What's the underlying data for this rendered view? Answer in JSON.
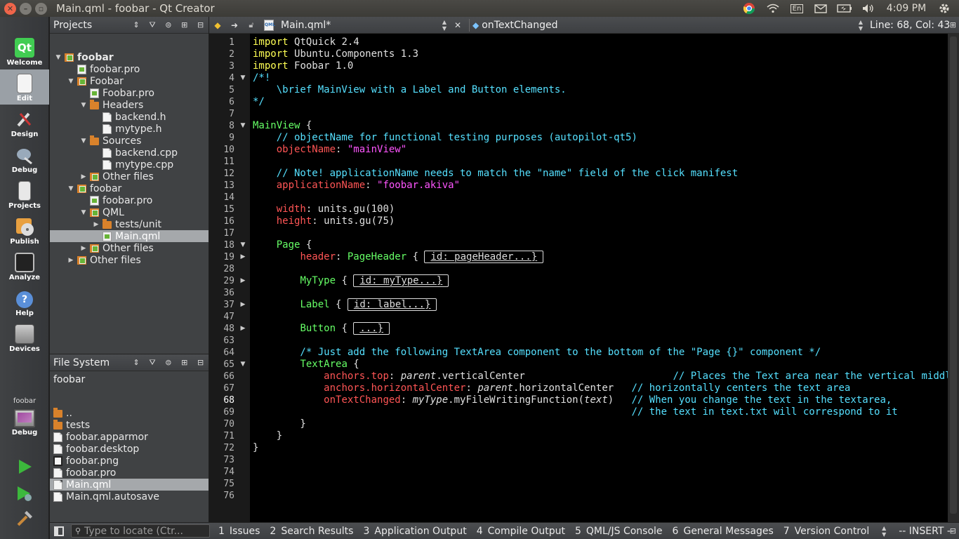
{
  "window": {
    "title": "Main.qml - foobar - Qt Creator",
    "clock": "4:09 PM",
    "keyboard_indicator": "En"
  },
  "modes": [
    {
      "label": "Welcome",
      "icon": "qt-logo-icon"
    },
    {
      "label": "Edit",
      "icon": "edit-document-icon",
      "active": true
    },
    {
      "label": "Design",
      "icon": "design-tools-icon"
    },
    {
      "label": "Debug",
      "icon": "debug-bug-icon"
    },
    {
      "label": "Projects",
      "icon": "projects-icon"
    },
    {
      "label": "Publish",
      "icon": "publish-disc-icon"
    },
    {
      "label": "Analyze",
      "icon": "analyze-monitor-icon"
    },
    {
      "label": "Help",
      "icon": "help-icon"
    },
    {
      "label": "Devices",
      "icon": "devices-icon"
    }
  ],
  "kit": {
    "name": "foobar",
    "label": "Debug"
  },
  "projects": {
    "title": "Projects",
    "items": [
      {
        "label": "foobar",
        "depth": 0,
        "arrow": "down",
        "icon": "proj",
        "bold": true
      },
      {
        "label": "foobar.pro",
        "depth": 1,
        "arrow": "",
        "icon": "qtproj"
      },
      {
        "label": "Foobar",
        "depth": 1,
        "arrow": "down",
        "icon": "proj"
      },
      {
        "label": "Foobar.pro",
        "depth": 2,
        "arrow": "",
        "icon": "qtproj"
      },
      {
        "label": "Headers",
        "depth": 2,
        "arrow": "down",
        "icon": "folder"
      },
      {
        "label": "backend.h",
        "depth": 3,
        "arrow": "",
        "icon": "file"
      },
      {
        "label": "mytype.h",
        "depth": 3,
        "arrow": "",
        "icon": "file"
      },
      {
        "label": "Sources",
        "depth": 2,
        "arrow": "down",
        "icon": "folder"
      },
      {
        "label": "backend.cpp",
        "depth": 3,
        "arrow": "",
        "icon": "file"
      },
      {
        "label": "mytype.cpp",
        "depth": 3,
        "arrow": "",
        "icon": "file"
      },
      {
        "label": "Other files",
        "depth": 2,
        "arrow": "right",
        "icon": "proj"
      },
      {
        "label": "foobar",
        "depth": 1,
        "arrow": "down",
        "icon": "proj"
      },
      {
        "label": "foobar.pro",
        "depth": 2,
        "arrow": "",
        "icon": "qtproj"
      },
      {
        "label": "QML",
        "depth": 2,
        "arrow": "down",
        "icon": "proj"
      },
      {
        "label": "tests/unit",
        "depth": 3,
        "arrow": "right",
        "icon": "folder"
      },
      {
        "label": "Main.qml",
        "depth": 3,
        "arrow": "",
        "icon": "qtproj",
        "selected": true
      },
      {
        "label": "Other files",
        "depth": 2,
        "arrow": "right",
        "icon": "proj"
      },
      {
        "label": "Other files",
        "depth": 1,
        "arrow": "right",
        "icon": "proj"
      }
    ]
  },
  "filesystem": {
    "title": "File System",
    "path": "foobar",
    "items": [
      {
        "label": "..",
        "icon": "folder"
      },
      {
        "label": "tests",
        "icon": "folder"
      },
      {
        "label": "foobar.apparmor",
        "icon": "file"
      },
      {
        "label": "foobar.desktop",
        "icon": "file"
      },
      {
        "label": "foobar.png",
        "icon": "img"
      },
      {
        "label": "foobar.pro",
        "icon": "file"
      },
      {
        "label": "Main.qml",
        "icon": "file",
        "selected": true
      },
      {
        "label": "Main.qml.autosave",
        "icon": "file"
      }
    ]
  },
  "editor": {
    "file": "Main.qml*",
    "symbol": "onTextChanged",
    "position": "Line: 68, Col: 43",
    "current_line": "68",
    "lines": [
      {
        "n": "1",
        "fold": "",
        "segs": [
          [
            "kw",
            "import"
          ],
          [
            "",
            "QtQuick 2.4"
          ]
        ]
      },
      {
        "n": "2",
        "fold": "",
        "segs": [
          [
            "kw",
            "import"
          ],
          [
            "",
            "Ubuntu.Components 1.3"
          ]
        ]
      },
      {
        "n": "3",
        "fold": "",
        "segs": [
          [
            "kw",
            "import"
          ],
          [
            "",
            "Foobar 1.0"
          ]
        ]
      },
      {
        "n": "4",
        "fold": "down",
        "segs": [
          [
            "cm",
            "/*!"
          ]
        ]
      },
      {
        "n": "5",
        "fold": "",
        "segs": [
          [
            "cm",
            "    \\brief MainView with a Label and Button elements."
          ]
        ]
      },
      {
        "n": "6",
        "fold": "",
        "segs": [
          [
            "cm",
            "*/"
          ]
        ]
      },
      {
        "n": "7",
        "fold": "",
        "segs": []
      },
      {
        "n": "8",
        "fold": "down",
        "segs": [
          [
            "ty",
            "MainView"
          ],
          [
            "",
            " {"
          ]
        ]
      },
      {
        "n": "9",
        "fold": "",
        "segs": [
          [
            "cm",
            "    // objectName for functional testing purposes (autopilot-qt5)"
          ]
        ]
      },
      {
        "n": "10",
        "fold": "",
        "segs": [
          [
            "",
            "    "
          ],
          [
            "pr",
            "objectName"
          ],
          [
            "",
            ": "
          ],
          [
            "st",
            "\"mainView\""
          ]
        ]
      },
      {
        "n": "11",
        "fold": "",
        "segs": []
      },
      {
        "n": "12",
        "fold": "",
        "segs": [
          [
            "cm",
            "    // Note! applicationName needs to match the \"name\" field of the click manifest"
          ]
        ]
      },
      {
        "n": "13",
        "fold": "",
        "segs": [
          [
            "",
            "    "
          ],
          [
            "pr",
            "applicationName"
          ],
          [
            "",
            ": "
          ],
          [
            "st",
            "\"foobar.akiva\""
          ]
        ]
      },
      {
        "n": "14",
        "fold": "",
        "segs": []
      },
      {
        "n": "15",
        "fold": "",
        "segs": [
          [
            "",
            "    "
          ],
          [
            "pr",
            "width"
          ],
          [
            "",
            ": units.gu(100)"
          ]
        ]
      },
      {
        "n": "16",
        "fold": "",
        "segs": [
          [
            "",
            "    "
          ],
          [
            "pr",
            "height"
          ],
          [
            "",
            ": units.gu(75)"
          ]
        ]
      },
      {
        "n": "17",
        "fold": "",
        "segs": []
      },
      {
        "n": "18",
        "fold": "down",
        "segs": [
          [
            "",
            "    "
          ],
          [
            "ty",
            "Page"
          ],
          [
            "",
            " {"
          ]
        ]
      },
      {
        "n": "19",
        "fold": "right",
        "segs": [
          [
            "",
            "        "
          ],
          [
            "pr",
            "header"
          ],
          [
            "",
            ": "
          ],
          [
            "ty",
            "PageHeader"
          ],
          [
            "",
            " { "
          ],
          [
            "box",
            "id: pageHeader...}"
          ]
        ]
      },
      {
        "n": "28",
        "fold": "",
        "segs": []
      },
      {
        "n": "29",
        "fold": "right",
        "segs": [
          [
            "",
            "        "
          ],
          [
            "ty",
            "MyType"
          ],
          [
            "",
            " { "
          ],
          [
            "box",
            "id: myType...}"
          ]
        ]
      },
      {
        "n": "36",
        "fold": "",
        "segs": []
      },
      {
        "n": "37",
        "fold": "right",
        "segs": [
          [
            "",
            "        "
          ],
          [
            "ty",
            "Label"
          ],
          [
            "",
            " { "
          ],
          [
            "box",
            "id: label...}"
          ]
        ]
      },
      {
        "n": "47",
        "fold": "",
        "segs": []
      },
      {
        "n": "48",
        "fold": "right",
        "segs": [
          [
            "",
            "        "
          ],
          [
            "ty",
            "Button"
          ],
          [
            "",
            " { "
          ],
          [
            "box",
            "...}"
          ]
        ]
      },
      {
        "n": "63",
        "fold": "",
        "segs": []
      },
      {
        "n": "64",
        "fold": "",
        "segs": [
          [
            "cm",
            "        /* Just add the following TextArea component to the bottom of the \"Page {}\" component */"
          ]
        ]
      },
      {
        "n": "65",
        "fold": "down",
        "segs": [
          [
            "",
            "        "
          ],
          [
            "ty",
            "TextArea"
          ],
          [
            "",
            " {"
          ]
        ]
      },
      {
        "n": "66",
        "fold": "",
        "segs": [
          [
            "",
            "            "
          ],
          [
            "pr",
            "anchors.top"
          ],
          [
            "",
            ": "
          ],
          [
            "it",
            "parent"
          ],
          [
            "",
            ".verticalCenter                         "
          ],
          [
            "cm",
            "// Places the Text area near the vertical middle"
          ]
        ]
      },
      {
        "n": "67",
        "fold": "",
        "segs": [
          [
            "",
            "            "
          ],
          [
            "pr",
            "anchors.horizontalCenter"
          ],
          [
            "",
            ": "
          ],
          [
            "it",
            "parent"
          ],
          [
            "",
            ".horizontalCenter   "
          ],
          [
            "cm",
            "// horizontally centers the text area"
          ]
        ]
      },
      {
        "n": "68",
        "fold": "",
        "segs": [
          [
            "",
            "            "
          ],
          [
            "pr",
            "onTextChanged"
          ],
          [
            "",
            ": "
          ],
          [
            "it",
            "myType"
          ],
          [
            "",
            ".myFileWritingFunction("
          ],
          [
            "it",
            "text"
          ],
          [
            "",
            ")   "
          ],
          [
            "cm",
            "// When you change the text in the textarea,"
          ]
        ]
      },
      {
        "n": "69",
        "fold": "",
        "segs": [
          [
            "cm",
            "                                                                // the text in text.txt will correspond to it"
          ]
        ]
      },
      {
        "n": "70",
        "fold": "",
        "segs": [
          [
            "",
            "        }"
          ]
        ]
      },
      {
        "n": "71",
        "fold": "",
        "segs": [
          [
            "",
            "    }"
          ]
        ]
      },
      {
        "n": "72",
        "fold": "",
        "segs": [
          [
            "",
            "}"
          ]
        ]
      },
      {
        "n": "73",
        "fold": "",
        "segs": []
      },
      {
        "n": "74",
        "fold": "",
        "segs": []
      },
      {
        "n": "75",
        "fold": "",
        "segs": []
      },
      {
        "n": "76",
        "fold": "",
        "segs": []
      }
    ]
  },
  "bottom": {
    "locator_placeholder": "Type to locate (Ctr...",
    "tabs": [
      {
        "num": "1",
        "label": "Issues"
      },
      {
        "num": "2",
        "label": "Search Results"
      },
      {
        "num": "3",
        "label": "Application Output"
      },
      {
        "num": "4",
        "label": "Compile Output"
      },
      {
        "num": "5",
        "label": "QML/JS Console"
      },
      {
        "num": "6",
        "label": "General Messages"
      },
      {
        "num": "7",
        "label": "Version Control"
      }
    ],
    "mode": "-- INSERT --"
  },
  "colors": {
    "keyword": "#ffff55",
    "comment": "#55e0ff",
    "type": "#66ff66",
    "property": "#ff5555",
    "string": "#ff55ff"
  }
}
